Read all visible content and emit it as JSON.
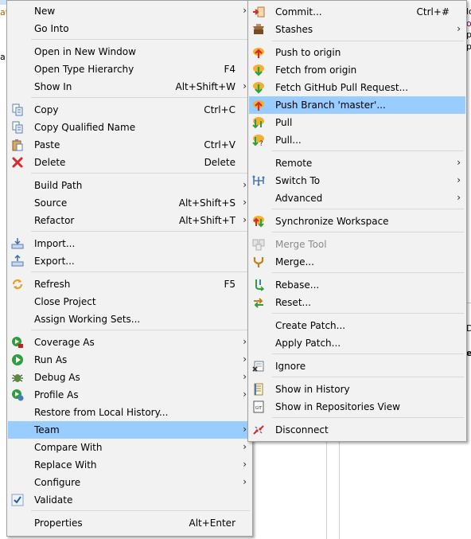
{
  "background": {
    "fragments": [
      "at",
      "a",
      "lo",
      "o",
      "p",
      "p",
      "D",
      "er"
    ]
  },
  "main_menu": {
    "items": [
      {
        "label": "New",
        "shortcut": "",
        "submenu": true,
        "icon": "none"
      },
      {
        "label": "Go Into",
        "shortcut": "",
        "submenu": false,
        "icon": "none"
      },
      {
        "label": "Open in New Window",
        "shortcut": "",
        "submenu": false,
        "icon": "none"
      },
      {
        "label": "Open Type Hierarchy",
        "shortcut": "F4",
        "submenu": false,
        "icon": "none"
      },
      {
        "label": "Show In",
        "shortcut": "Alt+Shift+W",
        "submenu": true,
        "icon": "none"
      },
      {
        "label": "Copy",
        "shortcut": "Ctrl+C",
        "submenu": false,
        "icon": "copy-icon"
      },
      {
        "label": "Copy Qualified Name",
        "shortcut": "",
        "submenu": false,
        "icon": "copy-qualified-name-icon"
      },
      {
        "label": "Paste",
        "shortcut": "Ctrl+V",
        "submenu": false,
        "icon": "paste-icon"
      },
      {
        "label": "Delete",
        "shortcut": "Delete",
        "submenu": false,
        "icon": "delete-icon"
      },
      {
        "label": "Build Path",
        "shortcut": "",
        "submenu": true,
        "icon": "none"
      },
      {
        "label": "Source",
        "shortcut": "Alt+Shift+S",
        "submenu": true,
        "icon": "none"
      },
      {
        "label": "Refactor",
        "shortcut": "Alt+Shift+T",
        "submenu": true,
        "icon": "none"
      },
      {
        "label": "Import...",
        "shortcut": "",
        "submenu": false,
        "icon": "import-icon"
      },
      {
        "label": "Export...",
        "shortcut": "",
        "submenu": false,
        "icon": "export-icon"
      },
      {
        "label": "Refresh",
        "shortcut": "F5",
        "submenu": false,
        "icon": "refresh-icon"
      },
      {
        "label": "Close Project",
        "shortcut": "",
        "submenu": false,
        "icon": "none"
      },
      {
        "label": "Assign Working Sets...",
        "shortcut": "",
        "submenu": false,
        "icon": "none"
      },
      {
        "label": "Coverage As",
        "shortcut": "",
        "submenu": true,
        "icon": "coverage-icon"
      },
      {
        "label": "Run As",
        "shortcut": "",
        "submenu": true,
        "icon": "run-icon"
      },
      {
        "label": "Debug As",
        "shortcut": "",
        "submenu": true,
        "icon": "debug-icon"
      },
      {
        "label": "Profile As",
        "shortcut": "",
        "submenu": true,
        "icon": "profile-icon"
      },
      {
        "label": "Restore from Local History...",
        "shortcut": "",
        "submenu": false,
        "icon": "none"
      },
      {
        "label": "Team",
        "shortcut": "",
        "submenu": true,
        "icon": "none",
        "highlighted": true
      },
      {
        "label": "Compare With",
        "shortcut": "",
        "submenu": true,
        "icon": "none"
      },
      {
        "label": "Replace With",
        "shortcut": "",
        "submenu": true,
        "icon": "none"
      },
      {
        "label": "Configure",
        "shortcut": "",
        "submenu": true,
        "icon": "none"
      },
      {
        "label": "Validate",
        "shortcut": "",
        "submenu": false,
        "icon": "validate-check-icon"
      },
      {
        "label": "Properties",
        "shortcut": "Alt+Enter",
        "submenu": false,
        "icon": "none"
      }
    ]
  },
  "team_menu": {
    "items": [
      {
        "label": "Commit...",
        "shortcut": "Ctrl+#",
        "submenu": false,
        "icon": "commit-icon"
      },
      {
        "label": "Stashes",
        "shortcut": "",
        "submenu": true,
        "icon": "stashes-icon"
      },
      {
        "label": "Push to origin",
        "shortcut": "",
        "submenu": false,
        "icon": "push-icon"
      },
      {
        "label": "Fetch from origin",
        "shortcut": "",
        "submenu": false,
        "icon": "fetch-icon"
      },
      {
        "label": "Fetch GitHub Pull Request...",
        "shortcut": "",
        "submenu": false,
        "icon": "fetch-pull-request-icon"
      },
      {
        "label": "Push Branch 'master'...",
        "shortcut": "",
        "submenu": false,
        "icon": "push-branch-icon",
        "highlighted": true
      },
      {
        "label": "Pull",
        "shortcut": "",
        "submenu": false,
        "icon": "pull-icon"
      },
      {
        "label": "Pull...",
        "shortcut": "",
        "submenu": false,
        "icon": "pull-dialog-icon"
      },
      {
        "label": "Remote",
        "shortcut": "",
        "submenu": true,
        "icon": "none"
      },
      {
        "label": "Switch To",
        "shortcut": "",
        "submenu": true,
        "icon": "switch-branch-icon"
      },
      {
        "label": "Advanced",
        "shortcut": "",
        "submenu": true,
        "icon": "none"
      },
      {
        "label": "Synchronize Workspace",
        "shortcut": "",
        "submenu": false,
        "icon": "synchronize-icon"
      },
      {
        "label": "Merge Tool",
        "shortcut": "",
        "submenu": false,
        "icon": "merge-tool-icon",
        "disabled": true
      },
      {
        "label": "Merge...",
        "shortcut": "",
        "submenu": false,
        "icon": "merge-icon"
      },
      {
        "label": "Rebase...",
        "shortcut": "",
        "submenu": false,
        "icon": "rebase-icon"
      },
      {
        "label": "Reset...",
        "shortcut": "",
        "submenu": false,
        "icon": "reset-icon"
      },
      {
        "label": "Create Patch...",
        "shortcut": "",
        "submenu": false,
        "icon": "none"
      },
      {
        "label": "Apply Patch...",
        "shortcut": "",
        "submenu": false,
        "icon": "none"
      },
      {
        "label": "Ignore",
        "shortcut": "",
        "submenu": false,
        "icon": "ignore-icon"
      },
      {
        "label": "Show in History",
        "shortcut": "",
        "submenu": false,
        "icon": "history-icon"
      },
      {
        "label": "Show in Repositories View",
        "shortcut": "",
        "submenu": false,
        "icon": "repositories-view-icon"
      },
      {
        "label": "Disconnect",
        "shortcut": "",
        "submenu": false,
        "icon": "disconnect-icon"
      }
    ]
  },
  "colors": {
    "highlight": "#99ccff",
    "menu_bg": "#f2f2f2",
    "separator": "#d7d7d7",
    "disabled_text": "#8a8a8a"
  }
}
